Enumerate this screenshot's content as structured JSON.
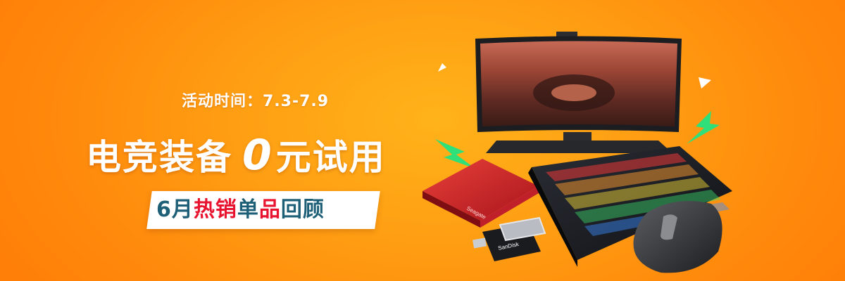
{
  "banner": {
    "event_time": "活动时间：7.3-7.9",
    "headline": {
      "part1": "电竞装备",
      "zero": "0",
      "part2": "元试用"
    },
    "subtitle": {
      "num": "6月",
      "hot": "热销",
      "single": "单",
      "product": "品",
      "review": "回顾"
    },
    "products": {
      "hdd_brand": "Seagate",
      "usb_brand": "SanDisk"
    },
    "icons": [
      "monitor-icon",
      "keyboard-icon",
      "mouse-icon",
      "hard-drive-icon",
      "usb-drive-icon",
      "lightning-icon",
      "triangle-icon"
    ]
  },
  "colors": {
    "background": "#ff9c12",
    "accent_red": "#e8132e",
    "accent_blue": "#1e5f78",
    "lightning_green": "#2fe07a"
  }
}
